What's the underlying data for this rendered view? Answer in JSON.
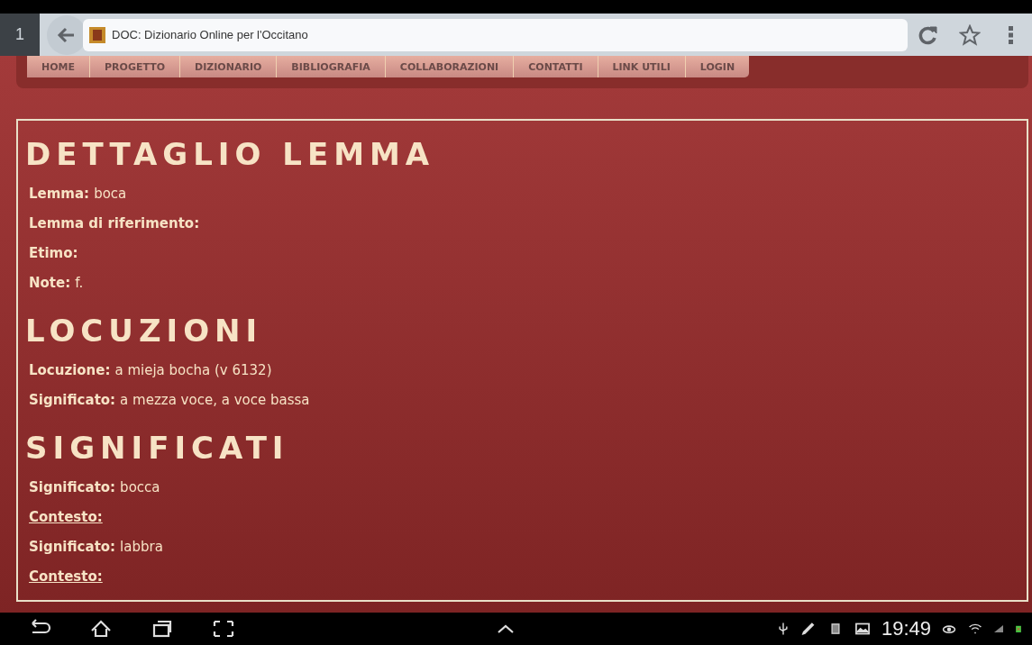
{
  "browser": {
    "tab_count": "1",
    "title": "DOC: Dizionario Online per l'Occitano"
  },
  "nav": [
    "HOME",
    "PROGETTO",
    "DIZIONARIO",
    "BIBLIOGRAFIA",
    "COLLABORAZIONI",
    "CONTATTI",
    "LINK UTILI",
    "LOGIN"
  ],
  "sections": [
    {
      "heading": "DETTAGLIO LEMMA",
      "rows": [
        {
          "kind": "field",
          "label": "Lemma:",
          "value": "boca"
        },
        {
          "kind": "field",
          "label": "Lemma di riferimento:"
        },
        {
          "kind": "field",
          "label": "Etimo:"
        },
        {
          "kind": "field",
          "label": "Note:",
          "value": "f."
        }
      ]
    },
    {
      "heading": "LOCUZIONI",
      "rows": [
        {
          "kind": "field",
          "label": "Locuzione:",
          "value": "a mieja bocha (v 6132)"
        },
        {
          "kind": "field",
          "label": "Significato:",
          "value": "a mezza voce, a voce bassa"
        }
      ]
    },
    {
      "heading": "SIGNIFICATI",
      "rows": [
        {
          "kind": "field",
          "label": "Significato:",
          "value": "bocca"
        },
        {
          "kind": "link",
          "label": "Contesto:"
        },
        {
          "kind": "field",
          "label": "Significato:",
          "value": "labbra"
        },
        {
          "kind": "link",
          "label": "Contesto:"
        }
      ]
    }
  ],
  "status_bar": {
    "time": "19:49"
  }
}
